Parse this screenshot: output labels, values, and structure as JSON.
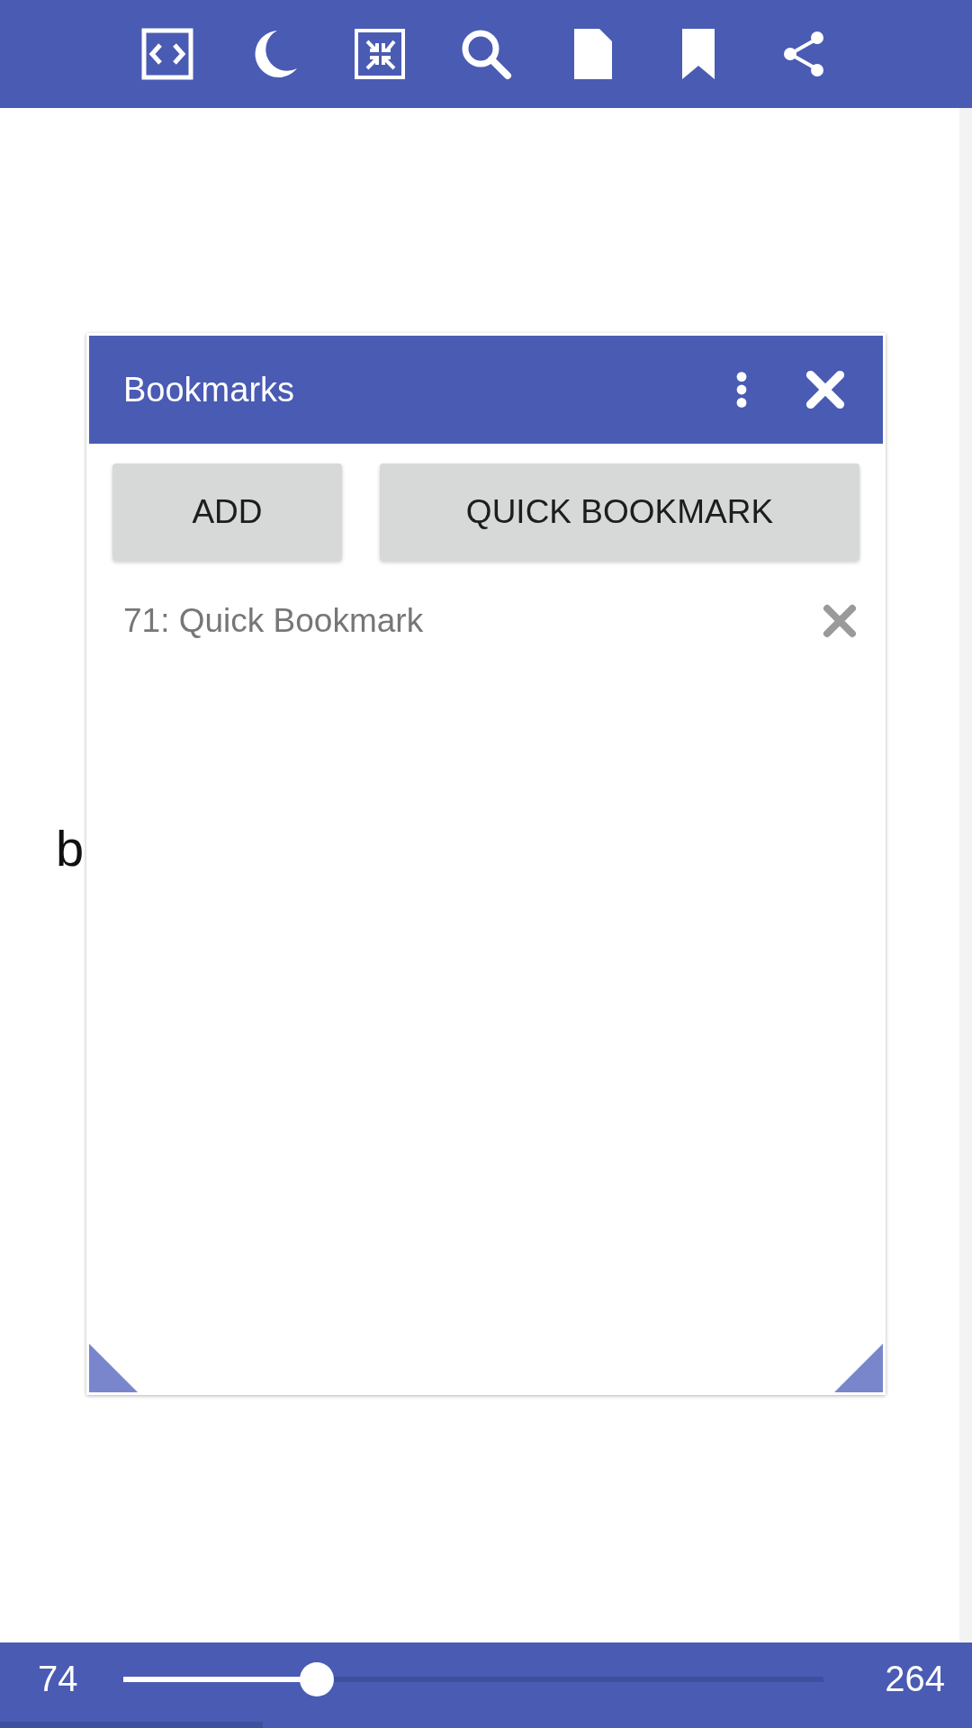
{
  "page_text": "b",
  "dialog": {
    "title": "Bookmarks",
    "buttons": [
      {
        "label": "ADD"
      },
      {
        "label": "QUICK BOOKMARK"
      }
    ],
    "bookmarks": [
      {
        "label": "71: Quick Bookmark"
      }
    ]
  },
  "bottom_bar": {
    "current_page": "74",
    "total_pages": "264",
    "slider": {
      "level": 0.277
    },
    "progress": {
      "level": 0.27
    }
  }
}
